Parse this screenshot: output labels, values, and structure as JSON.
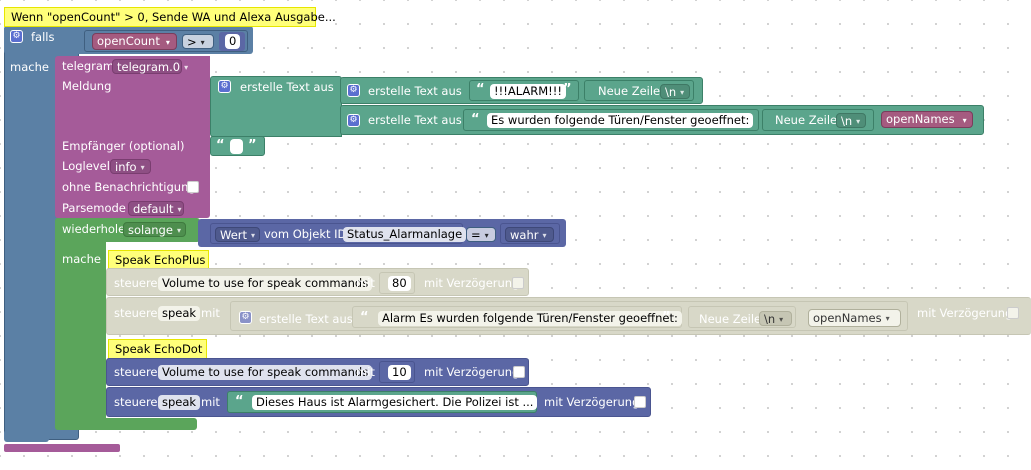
{
  "colors": {
    "control": "#5b80a5",
    "telegram": "#a55b99",
    "loop": "#5ba55b",
    "text": "#5ba58c",
    "object": "#5b67a5",
    "speak_disabled": "#d8d8c8",
    "variable": "#a55b80",
    "comment": "#ffff7a"
  },
  "comment_main": "Wenn \"openCount\" > 0, Sende WA und Alexa Ausgabe...",
  "if_block": {
    "falls": "falls",
    "mache": "mache",
    "var": "openCount",
    "op": ">",
    "value": "0"
  },
  "telegram": {
    "label": "telegram",
    "instance": "telegram.0",
    "meldung": "Meldung",
    "empfaenger": "Empfänger (optional)",
    "loglevel": "Loglevel",
    "loglevel_value": "info",
    "ohne": "ohne Benachrichtigung",
    "parsemode": "Parsemode",
    "parsemode_value": "default"
  },
  "text_outer": {
    "label": "erstelle Text aus"
  },
  "text_alarm": {
    "label": "erstelle Text aus",
    "string": "!!!ALARM!!!",
    "newline_label": "Neue Zeile",
    "newline_value": "\\n"
  },
  "text_doors": {
    "label": "erstelle Text aus",
    "string": "Es wurden folgende Türen/Fenster geoeffnet:",
    "newline_label": "Neue Zeile",
    "newline_value": "\\n",
    "var": "openNames"
  },
  "while_block": {
    "label": "wiederhole",
    "mode": "solange",
    "mache": "mache",
    "wert": "Wert",
    "vom": "vom Objekt ID",
    "object_id": "Status_Alarmanlage",
    "op": "=",
    "value": "wahr"
  },
  "comment_plus": "Speak EchoPlus",
  "comment_dot": "Speak EchoDot",
  "speak_plus_volume": {
    "steuere": "steuere",
    "command": "Volume to use for speak commands",
    "mit": "mit",
    "value": "80",
    "delay": "mit Verzögerung"
  },
  "speak_plus_speak": {
    "steuere": "steuere",
    "command": "speak",
    "mit": "mit",
    "text_label": "erstelle Text aus",
    "string": "Alarm Es wurden folgende Türen/Fenster geoeffnet:",
    "newline_label": "Neue Zeile",
    "newline_value": "\\n",
    "var": "openNames",
    "delay": "mit Verzögerung"
  },
  "speak_dot_volume": {
    "steuere": "steuere",
    "command": "Volume to use for speak commands",
    "mit": "mit",
    "value": "10",
    "delay": "mit Verzögerung"
  },
  "speak_dot_speak": {
    "steuere": "steuere",
    "command": "speak",
    "mit": "mit",
    "string": "Dieses Haus ist Alarmgesichert. Die Polizei ist ...",
    "delay": "mit Verzögerung"
  },
  "quote_open": "“",
  "quote_close": "”"
}
